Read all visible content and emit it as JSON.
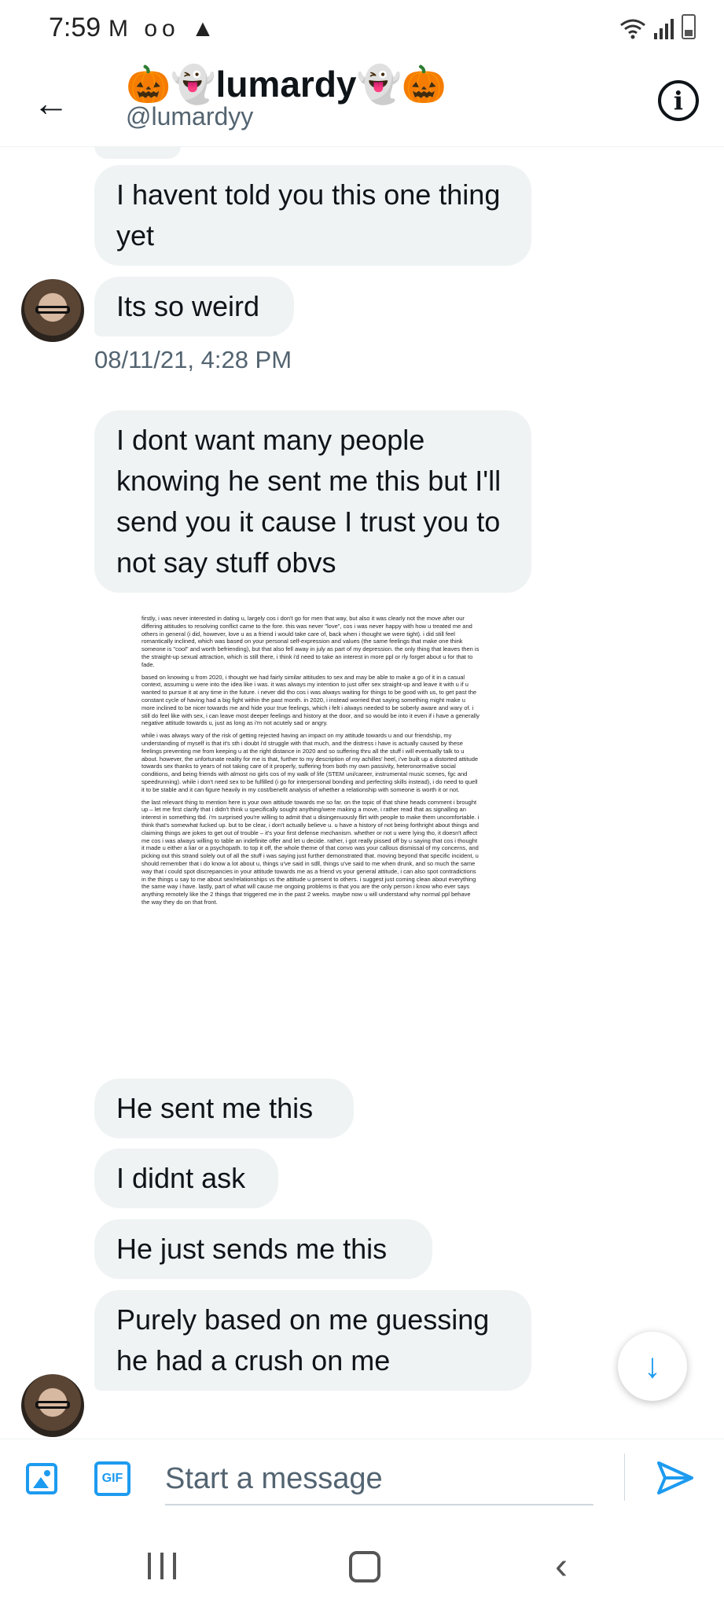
{
  "status_bar": {
    "time": "7:59",
    "left_icons": [
      "gmail-icon",
      "voicemail-icon",
      "navigation-icon"
    ],
    "right_icons": [
      "wifi-icon",
      "signal-icon",
      "battery-icon"
    ]
  },
  "header": {
    "display_name": "🎃👻lumardy👻🎃",
    "handle": "@lumardyy"
  },
  "messages": [
    {
      "text": "I havent told you this one thing yet"
    },
    {
      "text": "Its so weird"
    },
    {
      "text": "I dont want many people knowing he sent me this but I'll send you it cause I trust you to not say stuff obvs"
    },
    {
      "text": "He sent me this"
    },
    {
      "text": "I didnt ask"
    },
    {
      "text": "He just sends me this"
    },
    {
      "text": "Purely based on me guessing he had a crush on me"
    }
  ],
  "timestamp": "08/11/21, 4:28 PM",
  "attachment_text": [
    "firstly, i was never interested in dating u, largely cos i don't go for men that way, but also it was clearly not the move after our differing attitudes to resolving conflict came to the fore. this was never \"love\", cos i was never happy with how u treated me and others in general (i did, however, love u as a friend i would take care of, back when i thought we were tight). i did still feel romantically inclined, which was based on your personal self-expression and values (the same feelings that make one think someone is \"cool\" and worth befriending), but that also fell away in july as part of my depression. the only thing that leaves then is the straight-up sexual attraction, which is still there, i think i'd need to take an interest in more ppl or rly forget about u for that to fade.",
    "based on knowing u from 2020, i thought we had fairly similar attitudes to sex and may be able to make a go of it in a casual context, assuming u were into the idea like i was. it was always my intention to just offer sex straight-up and leave it with u if u wanted to pursue it at any time in the future. i never did tho cos i was always waiting for things to be good with us, to get past the constant cycle of having had a big fight within the past month. in 2020, i instead worried that saying something might make u more inclined to be nicer towards me and hide your true feelings, which i felt i always needed to be soberly aware and wary of. i still do feel like with sex, i can leave most deeper feelings and history at the door, and so would be into it even if i have a generally negative attitude towards u, just as long as i'm not acutely sad or angry.",
    "while i was always wary of the risk of getting rejected having an impact on my attitude towards u and our friendship, my understanding of myself is that it's sth i doubt i'd struggle with that much, and the distress i have is actually caused by these feelings preventing me from keeping u at the right distance in 2020 and so suffering thru all the stuff i will eventually talk to u about. however, the unfortunate reality for me is that, further to my description of my achilles' heel, i've built up a distorted attitude towards sex thanks to years of not taking care of it properly, suffering from both my own passivity, heteronormative social conditions, and being friends with almost no girls cos of my walk of life (STEM uni/career, instrumental music scenes, fgc and speedrunning). while i don't need sex to be fulfilled (i go for interpersonal bonding and perfecting skills instead), i do need to quell it to be stable and it can figure heavily in my cost/benefit analysis of whether a relationship with someone is worth it or not.",
    "the last relevant thing to mention here is your own attitude towards me so far. on the topic of that shine heads comment i brought up – let me first clarify that i didn't think u specifically sought anything/were making a move, i rather read that as signalling an interest in something tbd. i'm surprised you're willing to admit that u disingenuously flirt with people to make them uncomfortable. i think that's somewhat fucked up. but to be clear, i don't actually believe u. u have a history of not being forthright about things and claiming things are jokes to get out of trouble – it's your first defense mechanism. whether or not u were lying tho, it doesn't affect me cos i was always willing to table an indefinite offer and let u decide. rather, i got really pissed off by u saying that cos i thought it made u either a liar or a psychopath. to top it off, the whole theme of that convo was your callous dismissal of my concerns, and picking out this strand solely out of all the stuff i was saying just further demonstrated that. moving beyond that specific incident, u should remember that i do know a lot about u, things u've said in sdll, things u've said to me when drunk, and so much the same way that i could spot discrepancies in your attitude towards me as a friend vs your general attitude, i can also spot contradictions in the things u say to me about sex/relationships vs the attitude u present to others. i suggest just coming clean about everything the same way i have. lastly, part of what will cause me ongoing problems is that you are the only person i know who ever says anything remotely like the 2 things that triggered me in the past 2 weeks. maybe now u will understand why normal ppl behave the way they do on that front."
  ],
  "composer": {
    "placeholder": "Start a message",
    "gif_label": "GIF"
  },
  "colors": {
    "accent": "#1d9bf0",
    "bubble": "#eff3f4",
    "text": "#0f1419",
    "secondary_text": "#536471"
  }
}
